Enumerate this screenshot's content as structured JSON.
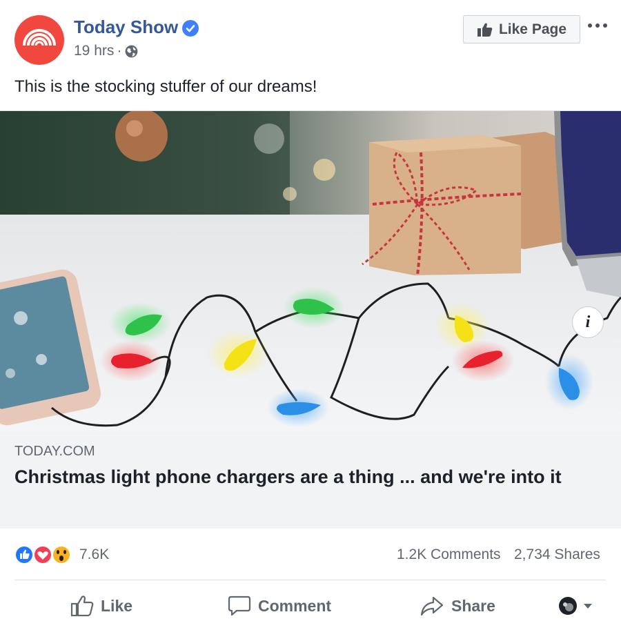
{
  "post": {
    "page_name": "Today Show",
    "timestamp": "19 hrs",
    "separator": "·",
    "like_page_label": "Like Page",
    "message": "This is the stocking stuffer of our dreams!"
  },
  "link": {
    "domain": "TODAY.COM",
    "headline": "Christmas light phone chargers are a thing ... and we're into it",
    "info_label": "i"
  },
  "stats": {
    "reaction_count": "7.6K",
    "comments": "1.2K Comments",
    "shares": "2,734 Shares"
  },
  "actions": {
    "like": "Like",
    "comment": "Comment",
    "share": "Share"
  },
  "colors": {
    "brand_link": "#365899",
    "verified": "#4080ff",
    "avatar": "#f0483e",
    "like_reaction": "#2078f4",
    "love_reaction": "#f33e58",
    "wow_reaction": "#f7b125"
  }
}
